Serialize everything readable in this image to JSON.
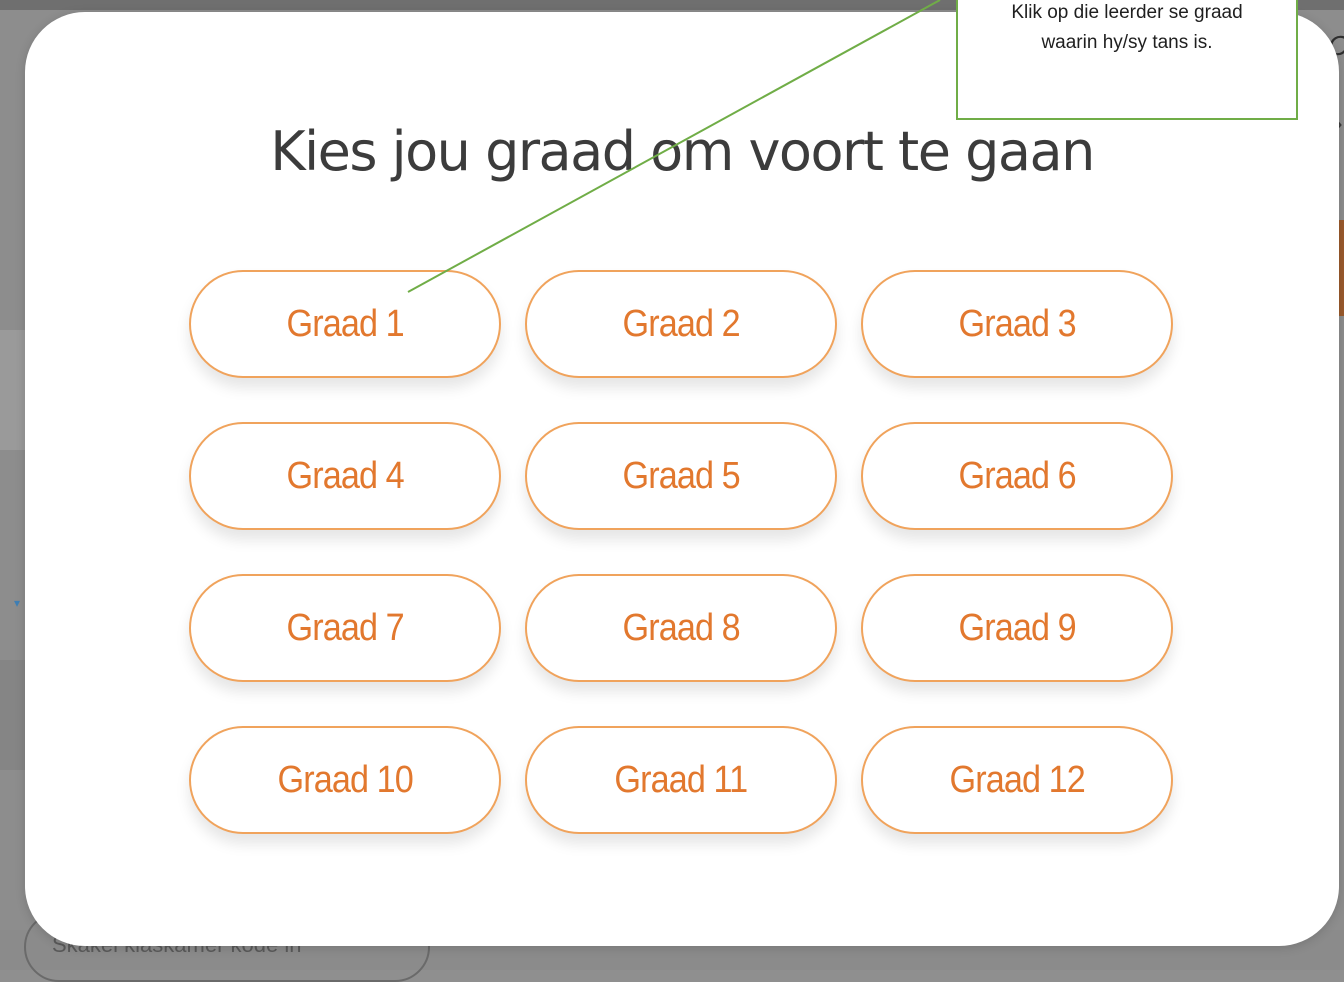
{
  "background": {
    "partial_button_text": "Skakel klaskamer kode in"
  },
  "modal": {
    "title": "Kies jou graad om voort te gaan",
    "accent_color": "#e2782e",
    "grades": [
      {
        "label": "Graad 1"
      },
      {
        "label": "Graad 2"
      },
      {
        "label": "Graad 3"
      },
      {
        "label": "Graad 4"
      },
      {
        "label": "Graad 5"
      },
      {
        "label": "Graad 6"
      },
      {
        "label": "Graad 7"
      },
      {
        "label": "Graad 8"
      },
      {
        "label": "Graad 9"
      },
      {
        "label": "Graad 10"
      },
      {
        "label": "Graad 11"
      },
      {
        "label": "Graad 12"
      }
    ]
  },
  "annotation": {
    "line_1": "Klik op die leerder se graad",
    "line_2": "waarin hy/sy tans is.",
    "border_color": "#70ad47"
  }
}
